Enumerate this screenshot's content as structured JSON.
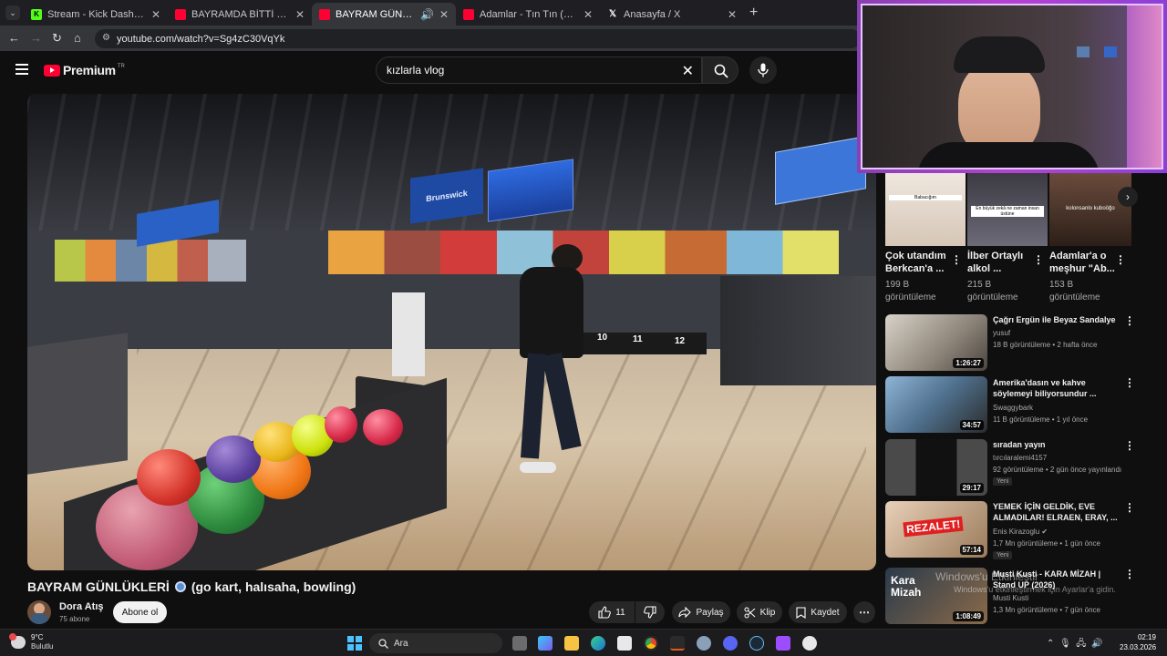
{
  "browser": {
    "tabs": [
      {
        "title": "Stream - Kick Dashboard",
        "favicon": "kick-icon"
      },
      {
        "title": "BAYRAMDA BİTTİ Kanser olduk",
        "favicon": "youtube-icon"
      },
      {
        "title": "BAYRAM GÜNLÜKLERİ",
        "favicon": "youtube-icon"
      },
      {
        "title": "Adamlar - Tın Tın (Official Audio)",
        "favicon": "youtube-icon"
      },
      {
        "title": "Anasayfa / X",
        "favicon": "x-icon"
      }
    ],
    "url": "youtube.com/watch?v=Sg4zC30VqYk"
  },
  "youtube": {
    "logo_text": "Premium",
    "logo_region": "TR",
    "search_query": "kızlarla vlog"
  },
  "video": {
    "title_main": "BAYRAM GÜNLÜKLERİ",
    "title_rest": "(go kart, halısaha, bowling)",
    "scene_labels": [
      "Brunswick",
      "10",
      "11",
      "12"
    ],
    "channel_name": "Dora Atış",
    "channel_subs": "75 abone",
    "subscribe_label": "Abone ol",
    "like_count": "11",
    "share_label": "Paylaş",
    "clip_label": "Klip",
    "save_label": "Kaydet"
  },
  "shorts": [
    {
      "title": "Çok utandım Berkcan'a ...",
      "views": "199 B görüntüleme",
      "caption": "Babacığım"
    },
    {
      "title": "İlber Ortaylı alkol ...",
      "views": "215 B görüntüleme",
      "caption": "En büyük zekâ ne zaman insan üstüne"
    },
    {
      "title": "Adamlar'a o meşhur \"Ab...",
      "views": "153 B görüntüleme",
      "caption": "kolonsanlo kuboöğo"
    }
  ],
  "recommendations": [
    {
      "title": "Çağrı Ergün ile Beyaz Sandalye",
      "channel": "yusuf",
      "meta": "18 B görüntüleme • 2 hafta önce",
      "duration": "1:26:27",
      "badge": ""
    },
    {
      "title": "Amerika'dasın ve kahve söylemeyi biliyorsundur ...",
      "channel": "Swaggybark",
      "meta": "11 B görüntüleme • 1 yıl önce",
      "duration": "34:57",
      "badge": ""
    },
    {
      "title": "sıradan yayın",
      "channel": "tırcılaralemi4157",
      "meta": "92 görüntüleme • 2 gün önce yayınlandı",
      "duration": "29:17",
      "badge": "Yeni"
    },
    {
      "title": "YEMEK İÇİN GELDİK, EVE ALMADILAR! ELRAEN, ERAY, ...",
      "channel": "Enis Kirazoglu",
      "meta": "1,7 Mn görüntüleme • 1 gün önce",
      "duration": "57:14",
      "badge": "Yeni",
      "thumb_text": "REZALET!"
    },
    {
      "title": "Musti Kusti - KARA MİZAH | Stand UP (2026)",
      "channel": "Musti Kusti",
      "meta": "1,3 Mn görüntüleme • 7 gün önce",
      "duration": "1:08:49",
      "badge": "",
      "thumb_text": "Kara Mizah"
    }
  ],
  "watermark": {
    "line1": "Windows'u Etkinleştir",
    "line2": "Windows'u etkinleştirmek için Ayarlar'a gidin."
  },
  "taskbar": {
    "temp": "9°C",
    "weather": "Bulutlu",
    "search_label": "Ara",
    "time": "02:19",
    "date": "23.03.2026"
  }
}
